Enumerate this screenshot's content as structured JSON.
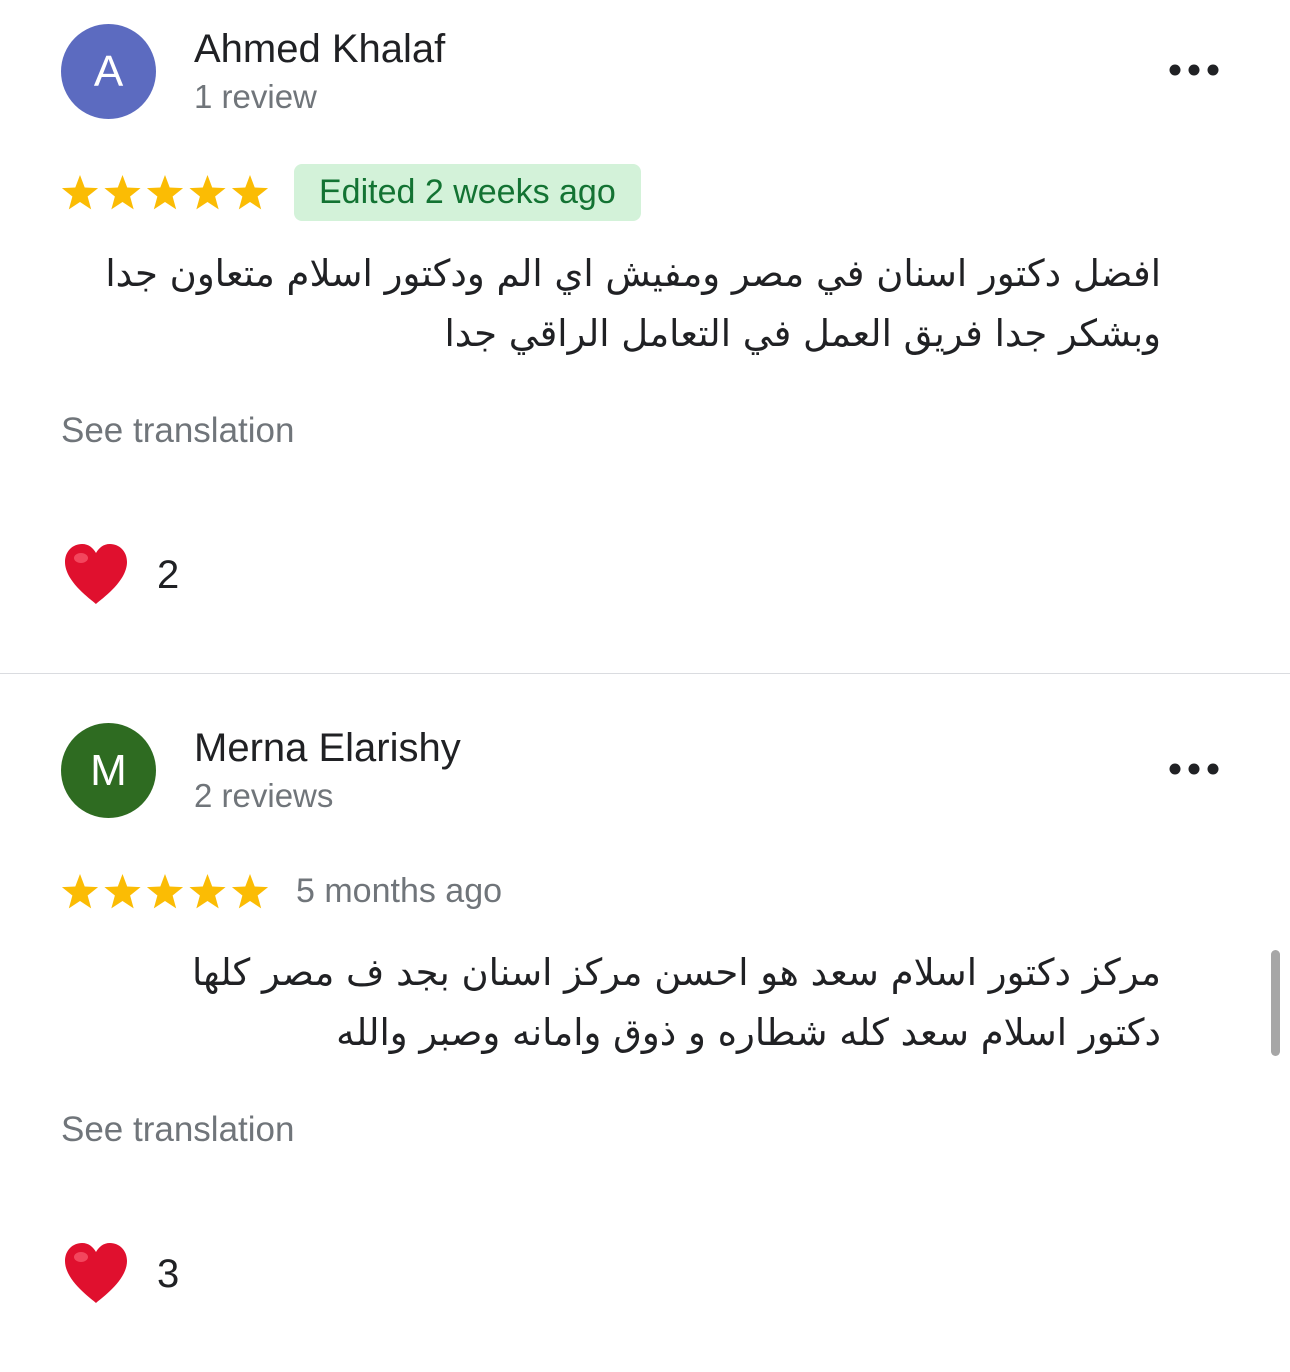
{
  "reviews": [
    {
      "avatar_letter": "A",
      "avatar_color": "#5c6bc0",
      "author": "Ahmed Khalaf",
      "review_count": "1 review",
      "rating": 5,
      "date": "Edited 2 weeks ago",
      "text_lines": [
        "افضل دكتور اسنان في مصر ومفيش اي الم ودكتور اسلام متعاون جدا",
        "وبشكر جدا فريق العمل في التعامل الراقي جدا"
      ],
      "see_translation": "See translation",
      "reaction_count": "2"
    },
    {
      "avatar_letter": "M",
      "avatar_color": "#2e6b21",
      "author": "Merna Elarishy",
      "review_count": "2 reviews",
      "rating": 5,
      "date": "5 months ago",
      "text_lines": [
        "مركز دكتور اسلام سعد هو احسن مركز اسنان بجد ف مصر كلها",
        "دكتور اسلام سعد كله شطاره و ذوق وامانه وصبر والله"
      ],
      "see_translation": "See translation",
      "reaction_count": "3"
    }
  ],
  "colors": {
    "star": "#fbbc04",
    "edited_badge_bg": "#d3f2d9",
    "edited_badge_text": "#137333",
    "secondary_text": "#70757a",
    "heart": "#e0102e"
  },
  "icons": {
    "more": "more-horizontal-icon",
    "star": "star-icon",
    "heart": "heart-icon"
  }
}
